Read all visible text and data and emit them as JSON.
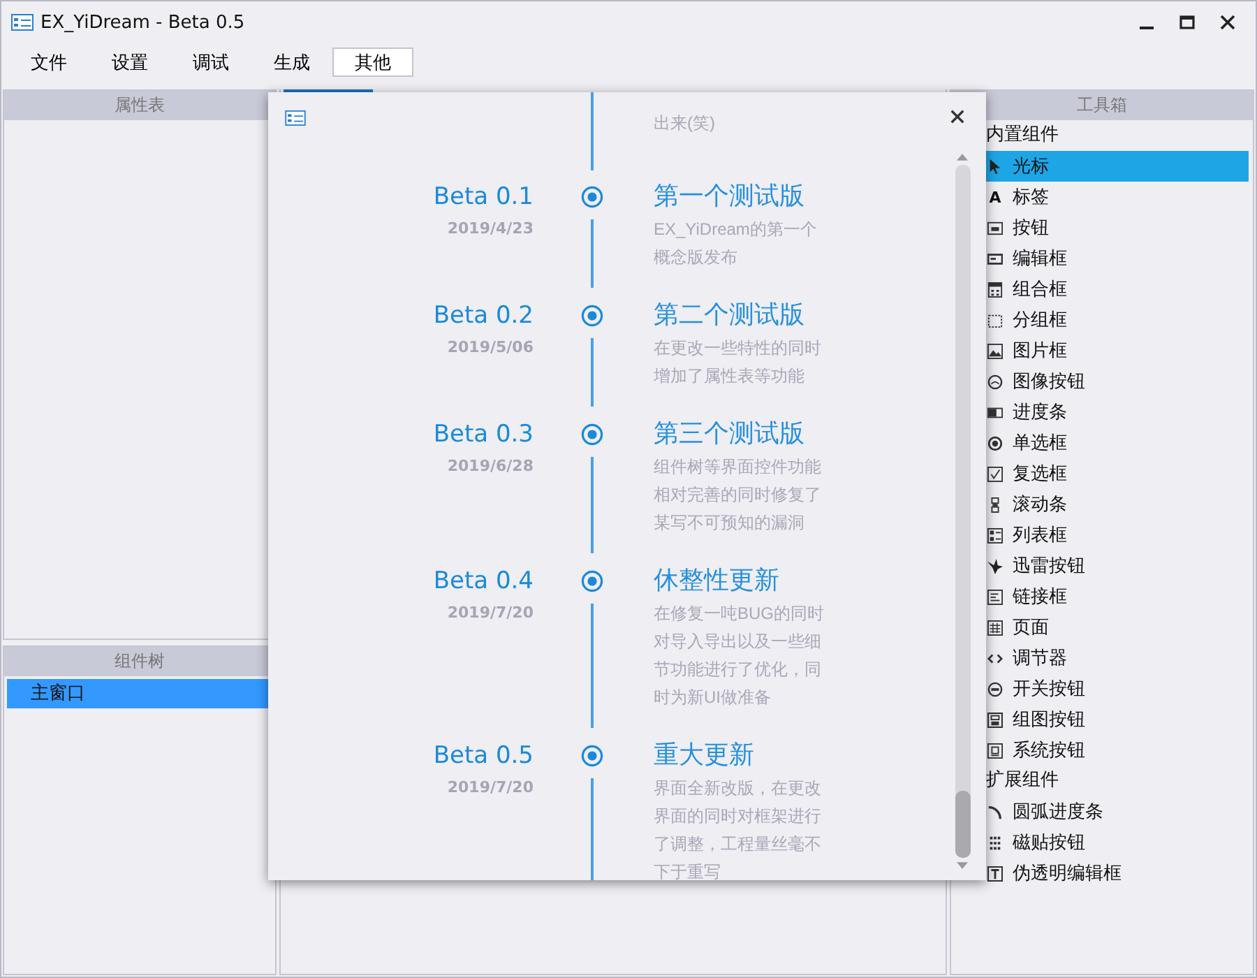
{
  "window": {
    "title": "EX_YiDream - Beta 0.5"
  },
  "menu": [
    {
      "label": "文件",
      "selected": false
    },
    {
      "label": "设置",
      "selected": false
    },
    {
      "label": "调试",
      "selected": false
    },
    {
      "label": "生成",
      "selected": false
    },
    {
      "label": "其他",
      "selected": true
    }
  ],
  "property_panel": {
    "title": "属性表"
  },
  "component_tree": {
    "title": "组件树",
    "items": [
      {
        "label": "主窗口",
        "selected": true
      }
    ]
  },
  "toolbox": {
    "title": "工具箱",
    "groups": [
      {
        "label": "内置组件",
        "items": [
          {
            "label": "光标",
            "selected": true
          },
          {
            "label": "标签",
            "selected": false,
            "glyph": "A"
          },
          {
            "label": "按钮",
            "selected": false
          },
          {
            "label": "编辑框",
            "selected": false
          },
          {
            "label": "组合框",
            "selected": false
          },
          {
            "label": "分组框",
            "selected": false
          },
          {
            "label": "图片框",
            "selected": false
          },
          {
            "label": "图像按钮",
            "selected": false
          },
          {
            "label": "进度条",
            "selected": false
          },
          {
            "label": "单选框",
            "selected": false
          },
          {
            "label": "复选框",
            "selected": false
          },
          {
            "label": "滚动条",
            "selected": false
          },
          {
            "label": "列表框",
            "selected": false
          },
          {
            "label": "迅雷按钮",
            "selected": false
          },
          {
            "label": "链接框",
            "selected": false
          },
          {
            "label": "页面",
            "selected": false
          },
          {
            "label": "调节器",
            "selected": false
          },
          {
            "label": "开关按钮",
            "selected": false
          },
          {
            "label": "组图按钮",
            "selected": false
          },
          {
            "label": "系统按钮",
            "selected": false
          }
        ]
      },
      {
        "label": "扩展组件",
        "items": [
          {
            "label": "圆弧进度条",
            "selected": false
          },
          {
            "label": "磁贴按钮",
            "selected": false
          },
          {
            "label": "伪透明编辑框",
            "selected": false
          }
        ]
      }
    ]
  },
  "dialog": {
    "intro_tail": "出来(笑)",
    "entries": [
      {
        "version": "Beta 0.1",
        "date": "2019/4/23",
        "title": "第一个测试版",
        "description": "EX_YiDream的第一个概念版发布"
      },
      {
        "version": "Beta 0.2",
        "date": "2019/5/06",
        "title": "第二个测试版",
        "description": "在更改一些特性的同时增加了属性表等功能"
      },
      {
        "version": "Beta 0.3",
        "date": "2019/6/28",
        "title": "第三个测试版",
        "description": "组件树等界面控件功能相对完善的同时修复了某写不可预知的漏洞"
      },
      {
        "version": "Beta 0.4",
        "date": "2019/7/20",
        "title": "休整性更新",
        "description": "在修复一吨BUG的同时对导入导出以及一些细节功能进行了优化，同时为新UI做准备"
      },
      {
        "version": "Beta 0.5",
        "date": "2019/7/20",
        "title": "重大更新",
        "description": "界面全新改版，在更改界面的同时对框架进行了调整，工程量丝毫不下于重写"
      }
    ]
  }
}
